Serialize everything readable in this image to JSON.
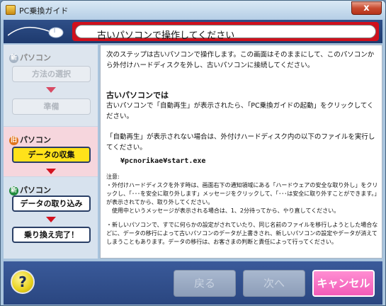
{
  "window": {
    "title": "PC乗換ガイド",
    "close_glyph": "x"
  },
  "header": {
    "title": "古いパソコンで操作してください"
  },
  "sidebar": {
    "sections": [
      {
        "badge": "新",
        "label": "パソコン",
        "steps": [
          "方法の選択",
          "準備"
        ]
      },
      {
        "badge": "旧",
        "label": "パソコン",
        "steps": [
          "データの収集"
        ]
      },
      {
        "badge": "新",
        "label": "パソコン",
        "steps": [
          "データの取り込み",
          "乗り換え完了！"
        ]
      }
    ]
  },
  "content": {
    "intro": "次のステップは古いパソコンで操作します。この画面はそのままにして、このパソコンから外付けハードディスクを外し、古いパソコンに接続してください。",
    "heading": "古いパソコンでは",
    "instruction": "古いパソコンで「自動再生」が表示されたら、「PC乗換ガイドの起動」をクリックしてください。",
    "fallback": "「自動再生」が表示されない場合は、外付けハードディスク内の以下のファイルを実行してください。",
    "path": "¥pcnorikae¥start.exe",
    "note_title": "注意:",
    "note1": "・外付けハードディスクを外す時は、画面右下の通知領域にある「ハードウェアの安全な取り外し」をクリックし、「･･･を安全に取り外します」メッセージをクリックして、「･･･は安全に取り外すことができます。」が表示されてから、取り外してください。",
    "note1b": "使用中というメッセージが表示される場合は、1、2分待ってから、やり直してください。",
    "note2": "・新しいパソコンで、すでに何らかの設定がされていたり、同じ名前のファイルを移行しようとした場合などに、データの移行によって古いパソコンのデータが上書きされ、新しいパソコンの設定やデータが消えてしまうこともあります。データの移行は、お客さまの判断と責任によって行ってください。"
  },
  "footer": {
    "help_label": "?",
    "back_label": "戻る",
    "next_label": "次へ",
    "cancel_label": "キャンセル"
  }
}
